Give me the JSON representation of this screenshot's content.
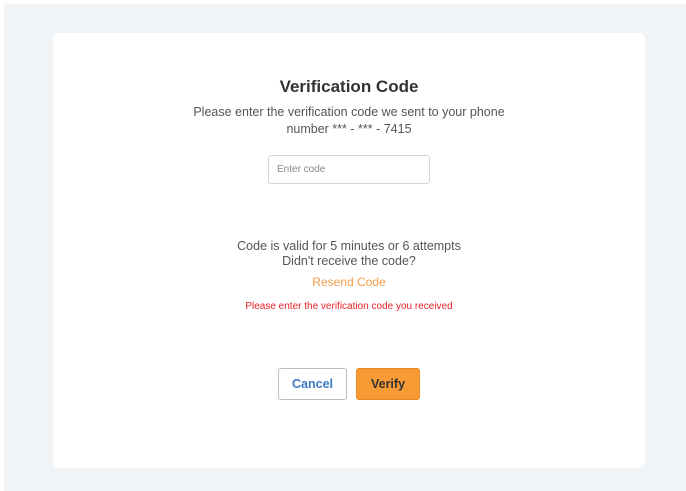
{
  "dialog": {
    "title": "Verification Code",
    "subtitle": "Please enter the verification code we sent to your phone number *** - *** - 7415",
    "code_input": {
      "value": "",
      "placeholder": "Enter code"
    },
    "validity_text": "Code is valid for 5 minutes or 6 attempts",
    "not_received_text": "Didn't receive the code?",
    "resend_label": "Resend Code",
    "error_text": "Please enter the verification code you received",
    "cancel_label": "Cancel",
    "verify_label": "Verify"
  },
  "colors": {
    "page_background": "#f1f4f7",
    "card_background": "#ffffff",
    "accent_orange": "#f99b35",
    "link_orange": "#f39c4a",
    "cancel_text_blue": "#3b78c5",
    "error_red": "#e8202a"
  }
}
